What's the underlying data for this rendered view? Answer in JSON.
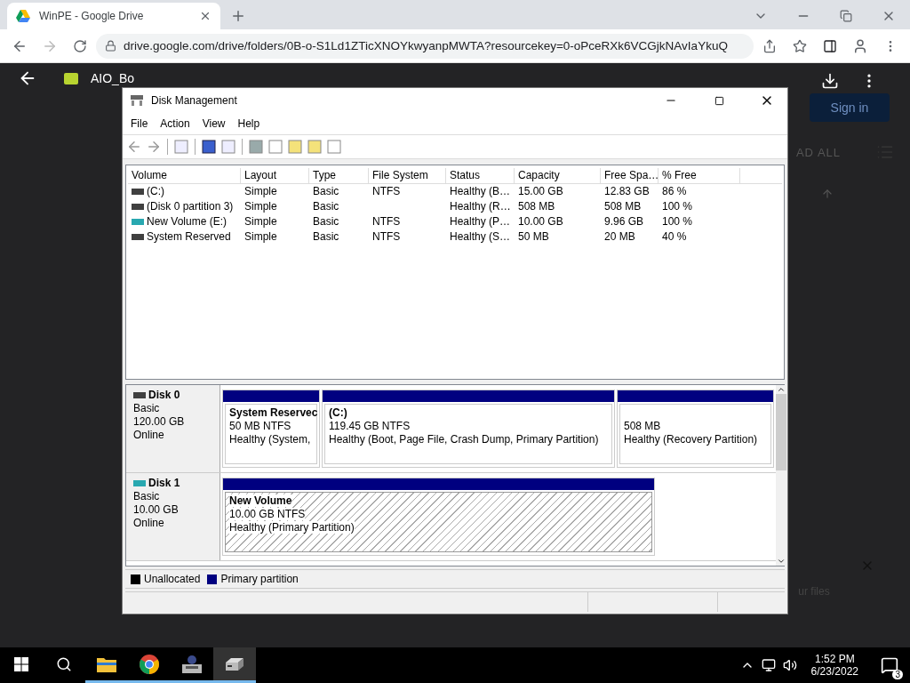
{
  "browser": {
    "tab_title": "WinPE - Google Drive",
    "url": "drive.google.com/drive/folders/0B-o-S1Ld1ZTicXNOYkwyanpMWTA?resourcekey=0-oPceRXk6VCGjkNAvIaYkuQ"
  },
  "viewer": {
    "file_name": "AIO_Bo",
    "sign_in": "Sign in",
    "header_action": "AD ALL",
    "toast_text": "ur files"
  },
  "window": {
    "title": "Disk Management",
    "menu": [
      "File",
      "Action",
      "View",
      "Help"
    ],
    "columns": [
      "Volume",
      "Layout",
      "Type",
      "File System",
      "Status",
      "Capacity",
      "Free Spa…",
      "% Free"
    ],
    "rows": [
      {
        "color": "#404040",
        "cells": [
          " (C:)",
          "Simple",
          "Basic",
          "NTFS",
          "Healthy (B…",
          "15.00 GB",
          "12.83 GB",
          "86 %"
        ]
      },
      {
        "color": "#404040",
        "cells": [
          "(Disk 0 partition 3)",
          "Simple",
          "Basic",
          "",
          "Healthy (R…",
          "508 MB",
          "508 MB",
          "100 %"
        ]
      },
      {
        "color": "#28a8b0",
        "cells": [
          "New Volume (E:)",
          "Simple",
          "Basic",
          "NTFS",
          "Healthy (P…",
          "10.00 GB",
          "9.96 GB",
          "100 %"
        ]
      },
      {
        "color": "#404040",
        "cells": [
          "System Reserved",
          "Simple",
          "Basic",
          "NTFS",
          "Healthy (S…",
          "50 MB",
          "20 MB",
          "40 %"
        ]
      }
    ],
    "disks": [
      {
        "name": "Disk 0",
        "color": "#404040",
        "type": "Basic",
        "size": "120.00 GB",
        "status": "Online",
        "partitions": [
          {
            "name": "System Reservec",
            "size": "50 MB NTFS",
            "status": "Healthy (System,",
            "selected": false
          },
          {
            "name": " (C:)",
            "size": "119.45 GB NTFS",
            "status": "Healthy (Boot, Page File, Crash Dump, Primary Partition)",
            "selected": false
          },
          {
            "size": "508 MB",
            "status": "Healthy (Recovery Partition)",
            "selected": false
          }
        ]
      },
      {
        "name": "Disk 1",
        "color": "#28a8b0",
        "type": "Basic",
        "size": "10.00 GB",
        "status": "Online",
        "partitions": [
          {
            "name": "New Volume",
            "size": "10.00 GB NTFS",
            "status": "Healthy (Primary Partition)",
            "selected": true
          }
        ]
      }
    ],
    "legend": [
      {
        "label": "Unallocated",
        "color": "#000000"
      },
      {
        "label": "Primary partition",
        "color": "#000080"
      }
    ]
  },
  "taskbar": {
    "apps": [
      {
        "kind": "explorer",
        "running": true,
        "selected": false
      },
      {
        "kind": "chrome",
        "running": true,
        "selected": false
      },
      {
        "kind": "tool",
        "running": true,
        "selected": false
      },
      {
        "kind": "disk",
        "running": true,
        "selected": true
      }
    ],
    "time": "1:52 PM",
    "date": "6/23/2022",
    "notifications": "3"
  }
}
